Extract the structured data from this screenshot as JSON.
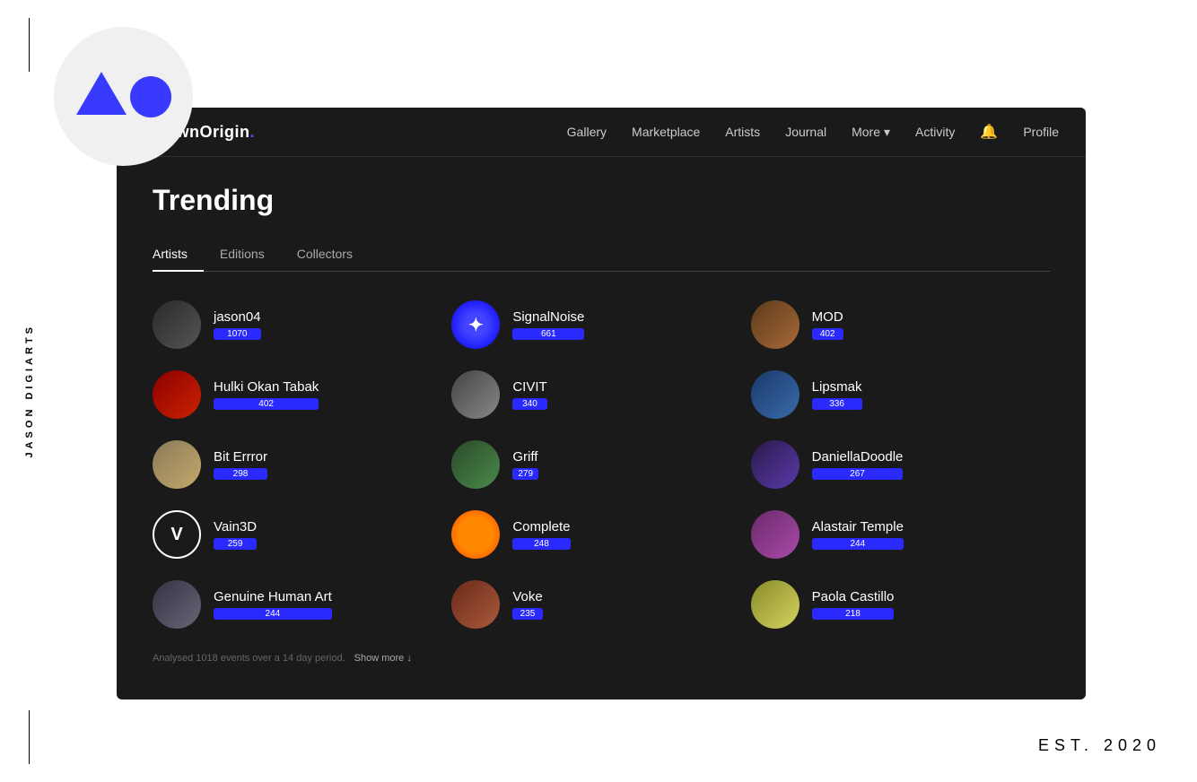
{
  "side": {
    "text": "JASON DIGIARTS"
  },
  "est": {
    "text": "EST. 2020"
  },
  "navbar": {
    "brand": "KnownOrigin",
    "brand_dot": ".",
    "links": [
      {
        "label": "Gallery",
        "name": "gallery-link"
      },
      {
        "label": "Marketplace",
        "name": "marketplace-link"
      },
      {
        "label": "Artists",
        "name": "artists-link"
      },
      {
        "label": "Journal",
        "name": "journal-link"
      },
      {
        "label": "More",
        "name": "more-link",
        "has_chevron": true
      },
      {
        "label": "Activity",
        "name": "activity-link"
      },
      {
        "label": "Profile",
        "name": "profile-link"
      }
    ]
  },
  "page": {
    "title": "Trending",
    "tabs": [
      {
        "label": "Artists",
        "active": true
      },
      {
        "label": "Editions",
        "active": false
      },
      {
        "label": "Collectors",
        "active": false
      }
    ],
    "footer_note": "Analysed 1018 events over a 14 day period.",
    "show_more": "Show more ↓"
  },
  "artists": [
    {
      "name": "jason04",
      "score": "1070",
      "avatar_class": "av-1",
      "avatar_text": ""
    },
    {
      "name": "SignalNoise",
      "score": "661",
      "avatar_class": "av-6",
      "avatar_text": "✦"
    },
    {
      "name": "MOD",
      "score": "402",
      "avatar_class": "av-10",
      "avatar_text": ""
    },
    {
      "name": "Hulki Okan Tabak",
      "score": "402",
      "avatar_class": "av-2",
      "avatar_text": ""
    },
    {
      "name": "CIVIT",
      "score": "340",
      "avatar_class": "av-11",
      "avatar_text": ""
    },
    {
      "name": "Lipsmak",
      "score": "336",
      "avatar_class": "av-7",
      "avatar_text": ""
    },
    {
      "name": "Bit Errror",
      "score": "298",
      "avatar_class": "av-3",
      "avatar_text": ""
    },
    {
      "name": "Griff",
      "score": "279",
      "avatar_class": "av-8",
      "avatar_text": ""
    },
    {
      "name": "DaniellaDoodle",
      "score": "267",
      "avatar_class": "av-12",
      "avatar_text": ""
    },
    {
      "name": "Vain3D",
      "score": "259",
      "avatar_class": "av-4",
      "avatar_text": "V"
    },
    {
      "name": "Complete",
      "score": "248",
      "avatar_class": "av-13",
      "avatar_text": ""
    },
    {
      "name": "Alastair Temple",
      "score": "244",
      "avatar_class": "av-9",
      "avatar_text": ""
    },
    {
      "name": "Genuine Human Art",
      "score": "244",
      "avatar_class": "av-5",
      "avatar_text": ""
    },
    {
      "name": "Voke",
      "score": "235",
      "avatar_class": "av-14",
      "avatar_text": ""
    },
    {
      "name": "Paola Castillo",
      "score": "218",
      "avatar_class": "av-15",
      "avatar_text": ""
    }
  ]
}
